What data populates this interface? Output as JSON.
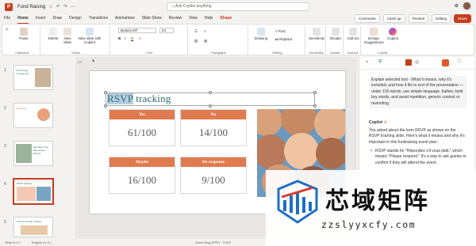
{
  "titlebar": {
    "doc_title": "Fund Raising",
    "search_placeholder": "Ask Copilot anything"
  },
  "tabs": [
    "File",
    "Home",
    "Insert",
    "Draw",
    "Design",
    "Transitions",
    "Animations",
    "Slide Show",
    "Review",
    "View",
    "Help",
    "Shape"
  ],
  "tab_actions": {
    "comments": "Comments",
    "catchup": "Catch up",
    "present": "Present",
    "editing": "Editing",
    "share": "Share"
  },
  "ribbon": {
    "paste": "Paste",
    "new_slide": "New Slide",
    "new_slide_copilot": "New slide with Copilot",
    "delete": "Delete",
    "font_name": "Bodoni MT",
    "font_size": "44",
    "drawing": "Drawing",
    "find": "Find",
    "replace": "Replace",
    "sensitivity": "Sensitivity",
    "dictate": "Dictate",
    "addins": "Add-ins",
    "design_suggestions": "Design Suggestions",
    "copilot": "Copilot",
    "groups": [
      "Clipboard",
      "Slides",
      "Font",
      "Paragraph",
      "Editing",
      "Sensitivity",
      "Dictate",
      "Add-ins",
      "Copilot"
    ]
  },
  "thumbnails": [
    {
      "num": "1",
      "text": "Fundraising strategy plan"
    },
    {
      "num": "2",
      "text": "Purposes"
    },
    {
      "num": "3",
      "text": "Riverside Tree Elementary School"
    },
    {
      "num": "4",
      "text": "RSVP tracking"
    },
    {
      "num": "5",
      "text": "Food and drink vendors"
    }
  ],
  "slide": {
    "title_hl": "RSVP",
    "title_rest": " tracking",
    "cells": [
      {
        "label": "Yes",
        "value": "61/100"
      },
      {
        "label": "No",
        "value": "14/100"
      },
      {
        "label": "Maybe",
        "value": "16/100"
      },
      {
        "label": "No response",
        "value": "9/100"
      }
    ]
  },
  "copilot": {
    "prompt": "Explain selected text - What it means, why it's included, and how it fits in rest of the presentation — under 150 words, use simple language, bullets, bold key words, and avoid repetition, generic context or rewording.",
    "name": "Copilot",
    "intro": "You asked about the term RSVP as shown on the RSVP tracking slide. Here's what it means and why it's important in this fundraising event plan:",
    "bullet": "RSVP stands for \"Répondez s'il vous plaît,\" which means \"Please respond.\" It's a way to ask guests to confirm if they will attend the event."
  },
  "status": {
    "slide": "Slide 4 of 7",
    "lang": "English (U.S.)",
    "theme": "Outer Ring (PPE) · TUS2"
  },
  "watermark": {
    "big": "芯域矩阵",
    "small": "zzslyyxcfy.com"
  },
  "colors": {
    "accent": "#c43e1c",
    "cell_header": "#e07b50",
    "title": "#2e6b6b"
  }
}
